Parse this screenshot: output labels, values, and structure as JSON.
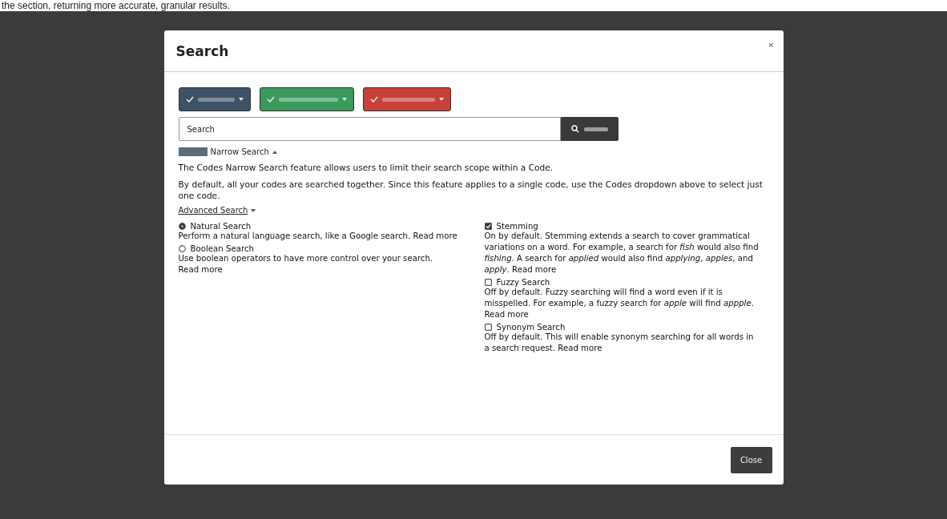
{
  "caption": "the section, returning more accurate, granular results.",
  "modal": {
    "title": "Search",
    "close_icon": "×",
    "filters": [
      {
        "color": "#3d5266"
      },
      {
        "color": "#3a9a5c"
      },
      {
        "color": "#c9403a"
      }
    ],
    "search": {
      "value": "Search"
    },
    "narrow": {
      "title": "Narrow Search",
      "expanded": true,
      "paragraphs": [
        "The Codes Narrow Search feature allows users to limit their search scope within a Code.",
        "By default, all your codes are searched together. Since this feature applies to a single code, use the Codes dropdown above to select just one code."
      ]
    },
    "advanced": {
      "title": "Advanced Search",
      "expanded": true,
      "modes": [
        {
          "label": "Natural Search",
          "selected": true,
          "description": "Perform a natural language search, like a Google search.",
          "link": "Read more"
        },
        {
          "label": "Boolean Search",
          "selected": false,
          "description": "Use boolean operators to have more control over your search.",
          "link": "Read more"
        }
      ],
      "options": [
        {
          "label": "Stemming",
          "checked": true,
          "description": "On by default. Stemming extends a search to cover grammatical variations on a word. For example, a search for *fish* would also find *fishing*. A search for *applied* would also find *applying*, *apples*, and *apply*.",
          "link": "Read more"
        },
        {
          "label": "Fuzzy Search",
          "checked": false,
          "description": "Off by default. Fuzzy searching will find a word even if it is misspelled. For example, a fuzzy search for *apple* will find *appple*.",
          "link": "Read more"
        },
        {
          "label": "Synonym Search",
          "checked": false,
          "description": "Off by default. This will enable synonym searching for all words in a search request.",
          "link": "Read more"
        }
      ]
    },
    "footer": {
      "button": "Close"
    }
  }
}
